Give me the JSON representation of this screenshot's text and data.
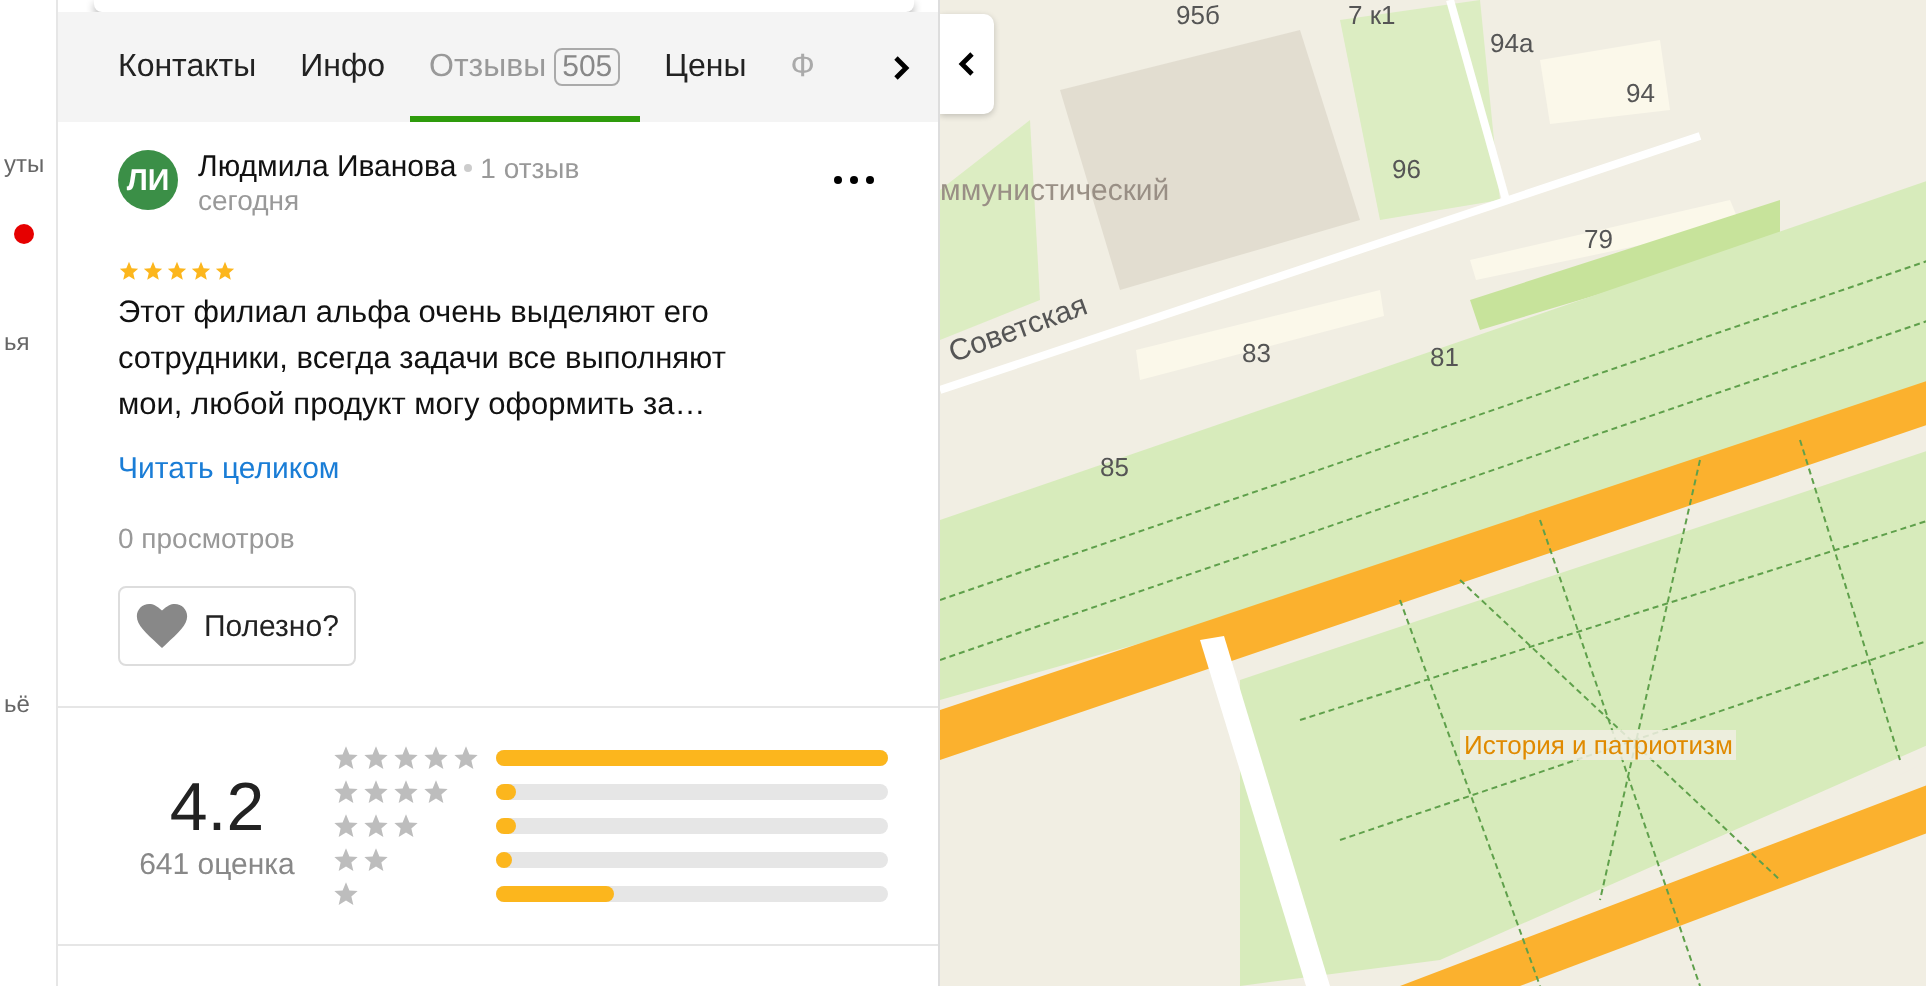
{
  "left_edge": {
    "items": [
      {
        "text": "уты"
      },
      {
        "text": "ья"
      },
      {
        "text": "ьё"
      }
    ]
  },
  "tabs": [
    {
      "label": "Контакты",
      "selected": false,
      "faded": false
    },
    {
      "label": "Инфо",
      "selected": false,
      "faded": false
    },
    {
      "label": "Отзывы",
      "badge": "505",
      "selected": true,
      "faded": false
    },
    {
      "label": "Цены",
      "selected": false,
      "faded": false
    },
    {
      "label": "Ф",
      "selected": false,
      "faded": true
    }
  ],
  "review": {
    "initials": "ЛИ",
    "author": "Людмила Иванова",
    "author_reviews": "1 отзыв",
    "date": "сегодня",
    "stars": 5,
    "text": "Этот филиал альфа очень выделяют его сотрудники, всегда задачи все выполняют мои, любой продукт могу оформить за…",
    "read_more": "Читать целиком",
    "views": "0 просмотров",
    "helpful_button": "Полезно?"
  },
  "summary": {
    "score": "4.2",
    "count": "641 оценка",
    "distribution": [
      {
        "level": 1.0
      },
      {
        "level": 0.05
      },
      {
        "level": 0.05
      },
      {
        "level": 0.04
      },
      {
        "level": 0.3
      }
    ]
  },
  "map": {
    "labels": [
      {
        "text": "95б",
        "kind": "building"
      },
      {
        "text": "7 к1",
        "kind": "building"
      },
      {
        "text": "94а",
        "kind": "building"
      },
      {
        "text": "94",
        "kind": "building"
      },
      {
        "text": "96",
        "kind": "building"
      },
      {
        "text": "ммунистический",
        "kind": "district"
      },
      {
        "text": "79",
        "kind": "building"
      },
      {
        "text": "83",
        "kind": "building"
      },
      {
        "text": "81",
        "kind": "building"
      },
      {
        "text": "85",
        "kind": "building"
      },
      {
        "text": "Советская",
        "kind": "street"
      },
      {
        "text": "История и патриотизм",
        "kind": "poi"
      }
    ]
  }
}
